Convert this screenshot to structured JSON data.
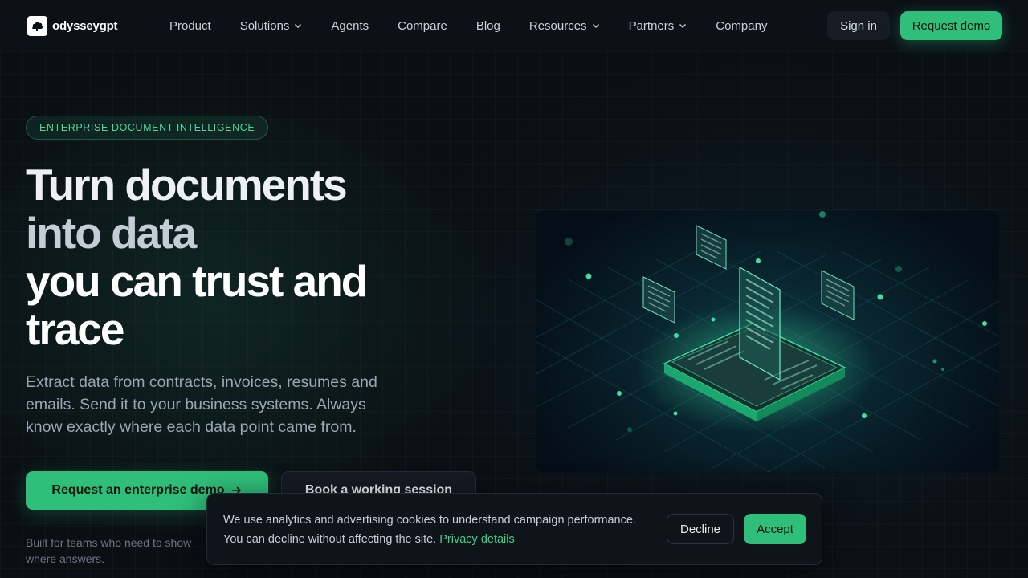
{
  "brand": {
    "name": "odysseygpt",
    "accent": "#2fbf7a"
  },
  "nav": {
    "items": [
      {
        "label": "Product",
        "dropdown": false
      },
      {
        "label": "Solutions",
        "dropdown": true
      },
      {
        "label": "Agents",
        "dropdown": false
      },
      {
        "label": "Compare",
        "dropdown": false
      },
      {
        "label": "Blog",
        "dropdown": false
      },
      {
        "label": "Resources",
        "dropdown": true
      },
      {
        "label": "Partners",
        "dropdown": true
      },
      {
        "label": "Company",
        "dropdown": false
      }
    ],
    "signin_label": "Sign in",
    "request_demo_label": "Request demo"
  },
  "hero": {
    "eyebrow": "ENTERPRISE DOCUMENT INTELLIGENCE",
    "headline": {
      "line1": "Turn documents",
      "line2": "into data",
      "line3": "you can trust and",
      "line4": "trace"
    },
    "subtext": "Extract data from contracts, invoices, resumes and emails. Send it to your business systems. Always know exactly where each data point came from.",
    "primary_cta": "Request an enterprise demo",
    "secondary_cta": "Book a working session",
    "footnote": "Built for teams who need to show where answers."
  },
  "cookie_banner": {
    "text": "We use analytics and advertising cookies to understand campaign performance. You can decline without affecting the site.",
    "link_label": "Privacy details",
    "decline_label": "Decline",
    "accept_label": "Accept"
  }
}
